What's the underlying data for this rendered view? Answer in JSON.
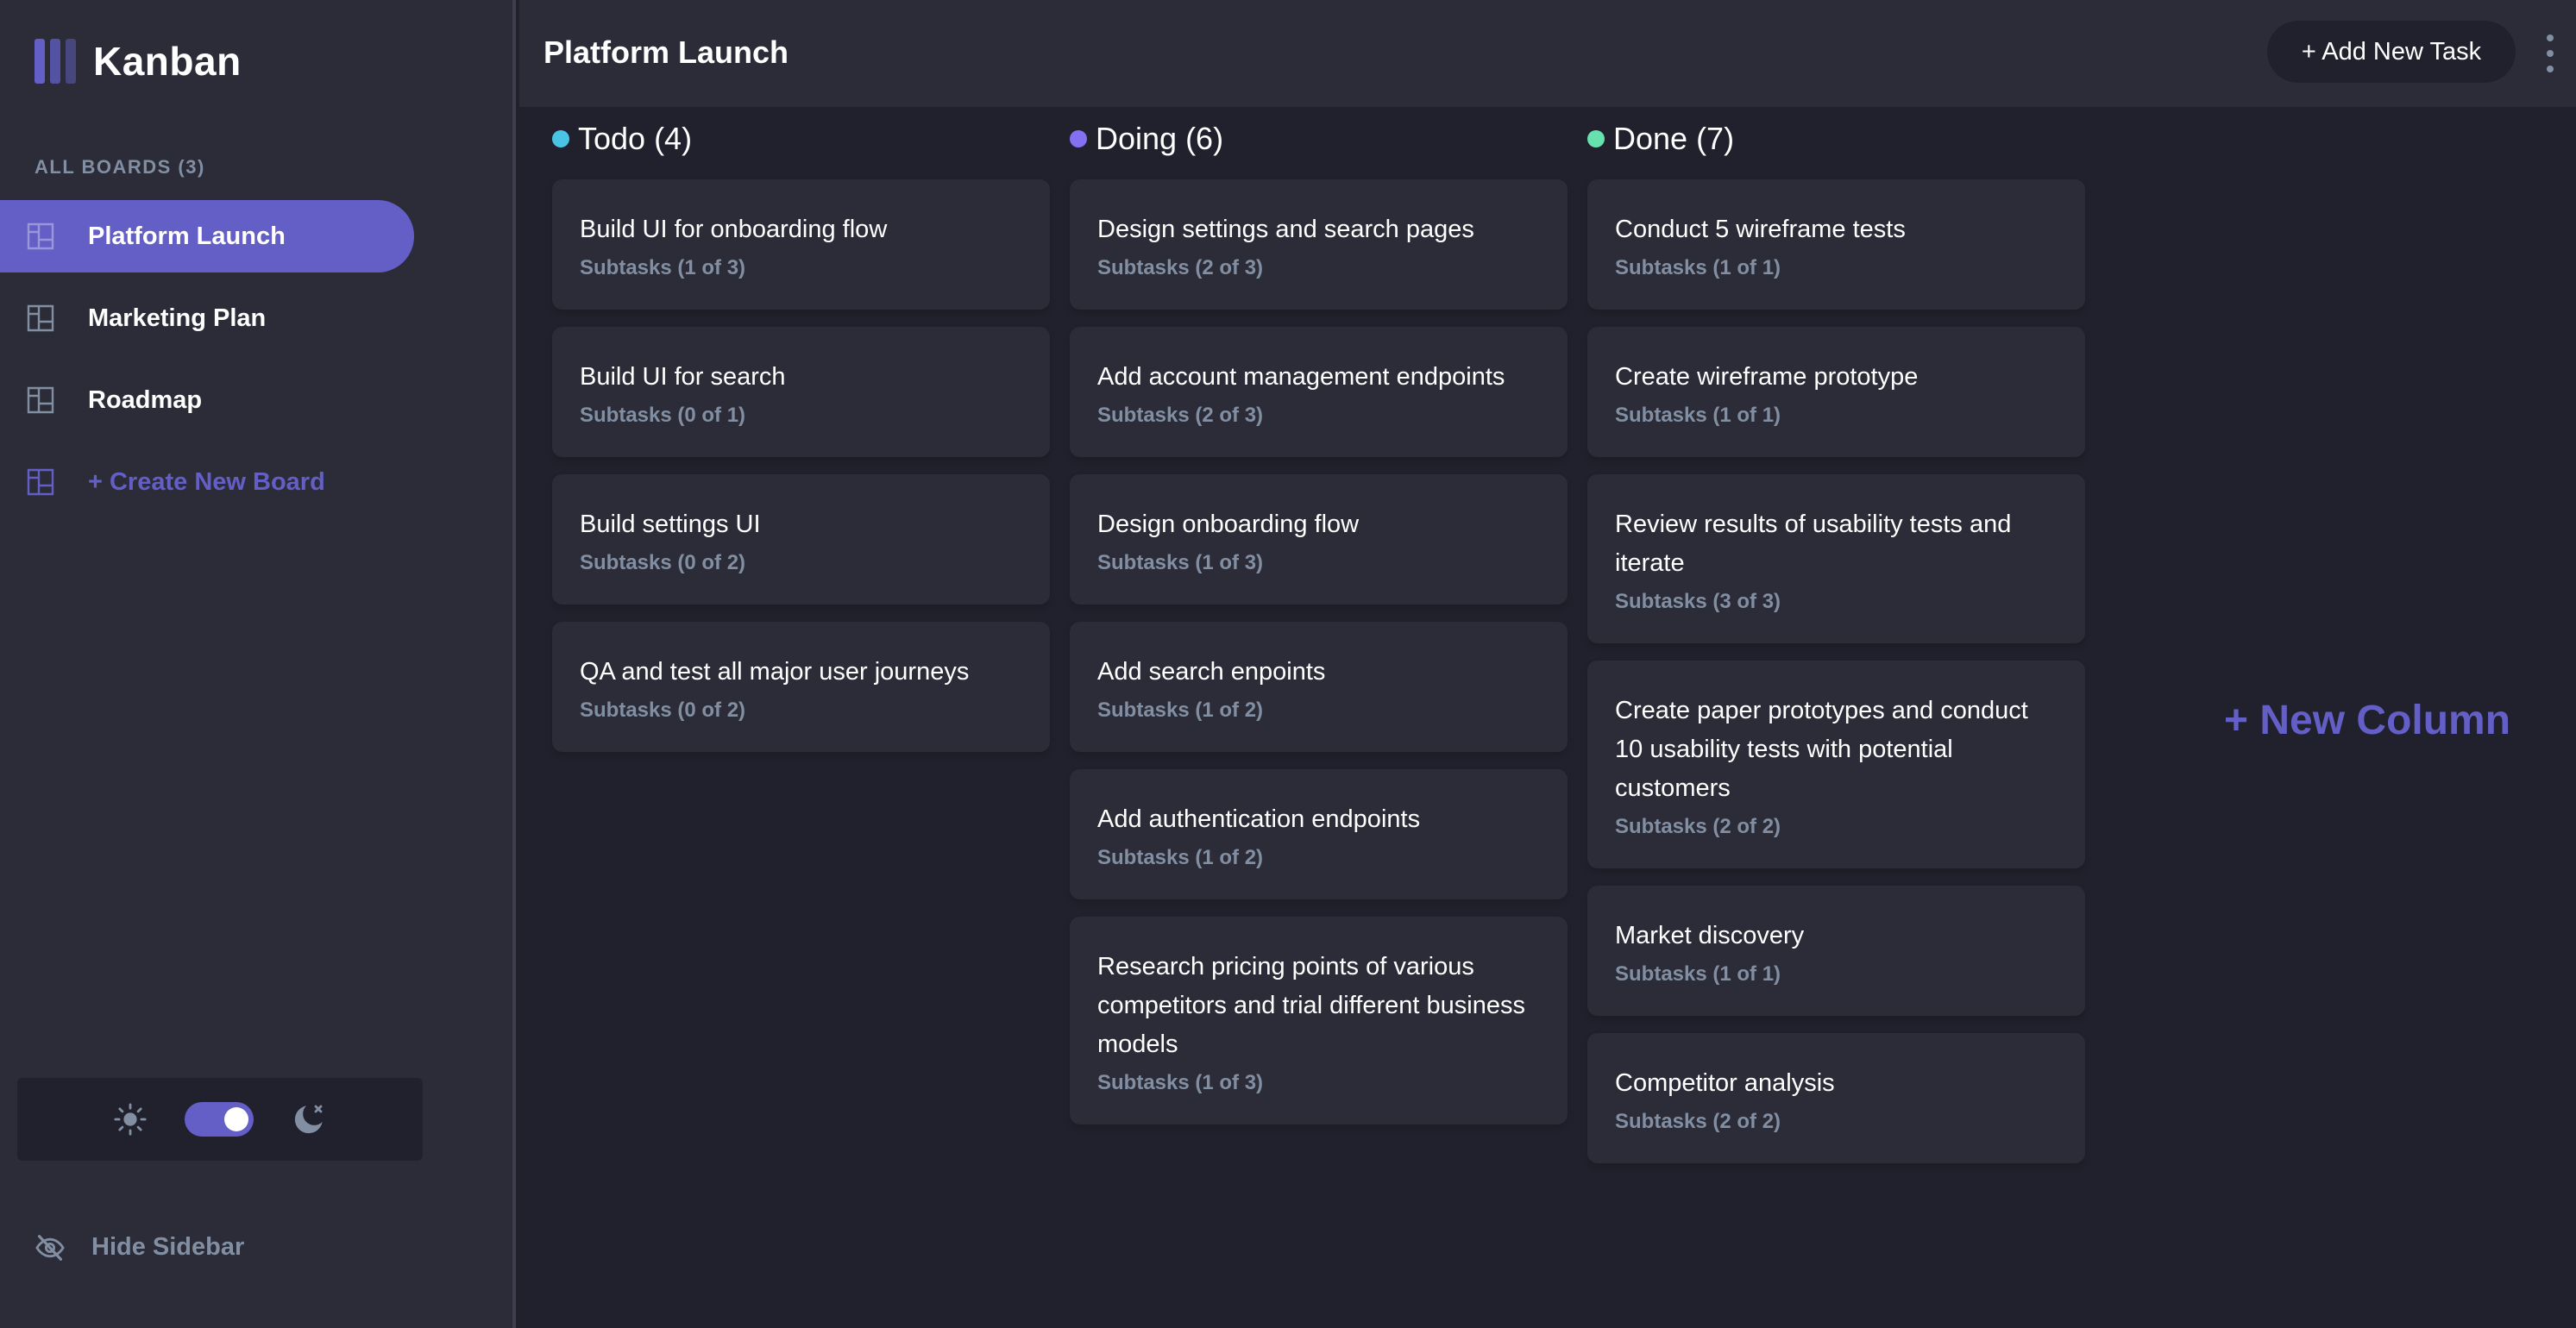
{
  "app": {
    "logo_text": "Kanban"
  },
  "sidebar": {
    "heading": "ALL BOARDS (3)",
    "boards": [
      {
        "label": "Platform Launch",
        "active": true
      },
      {
        "label": "Marketing Plan",
        "active": false
      },
      {
        "label": "Roadmap",
        "active": false
      }
    ],
    "create_label": "+ Create New Board",
    "hide_label": "Hide Sidebar",
    "theme": "dark"
  },
  "header": {
    "title": "Platform Launch",
    "add_task_label": "+ Add New Task"
  },
  "columns": [
    {
      "title": "Todo (4)",
      "color": "#49c4e5",
      "cards": [
        {
          "title": "Build UI for onboarding flow",
          "subtasks": "Subtasks (1 of 3)"
        },
        {
          "title": "Build UI for search",
          "subtasks": "Subtasks (0 of 1)"
        },
        {
          "title": "Build settings UI",
          "subtasks": "Subtasks (0 of 2)"
        },
        {
          "title": "QA and test all major user journeys",
          "subtasks": "Subtasks (0 of 2)"
        }
      ]
    },
    {
      "title": "Doing (6)",
      "color": "#8471f2",
      "cards": [
        {
          "title": "Design settings and search pages",
          "subtasks": "Subtasks (2 of 3)"
        },
        {
          "title": "Add account management endpoints",
          "subtasks": "Subtasks (2 of 3)"
        },
        {
          "title": "Design onboarding flow",
          "subtasks": "Subtasks (1 of 3)"
        },
        {
          "title": "Add search enpoints",
          "subtasks": "Subtasks (1 of 2)"
        },
        {
          "title": "Add authentication endpoints",
          "subtasks": "Subtasks (1 of 2)"
        },
        {
          "title": "Research pricing points of various competitors and trial different business models",
          "subtasks": "Subtasks (1 of 3)"
        }
      ]
    },
    {
      "title": "Done (7)",
      "color": "#67e2ae",
      "cards": [
        {
          "title": "Conduct 5 wireframe tests",
          "subtasks": "Subtasks (1 of 1)"
        },
        {
          "title": "Create wireframe prototype",
          "subtasks": "Subtasks (1 of 1)"
        },
        {
          "title": "Review results of usability tests and iterate",
          "subtasks": "Subtasks (3 of 3)"
        },
        {
          "title": "Create paper prototypes and conduct 10 usability tests with potential customers",
          "subtasks": "Subtasks (2 of 2)"
        },
        {
          "title": "Market discovery",
          "subtasks": "Subtasks (1 of 1)"
        },
        {
          "title": "Competitor analysis",
          "subtasks": "Subtasks (2 of 2)"
        }
      ]
    }
  ],
  "new_column_label": "+ New Column",
  "colors": {
    "accent": "#635fc7",
    "bg": "#20212c",
    "panel": "#2b2c37",
    "muted": "#828fa3"
  },
  "icons": [
    "logo-icon",
    "board-icon",
    "sun-icon",
    "moon-icon",
    "hide-eye-icon",
    "more-vertical-icon"
  ]
}
